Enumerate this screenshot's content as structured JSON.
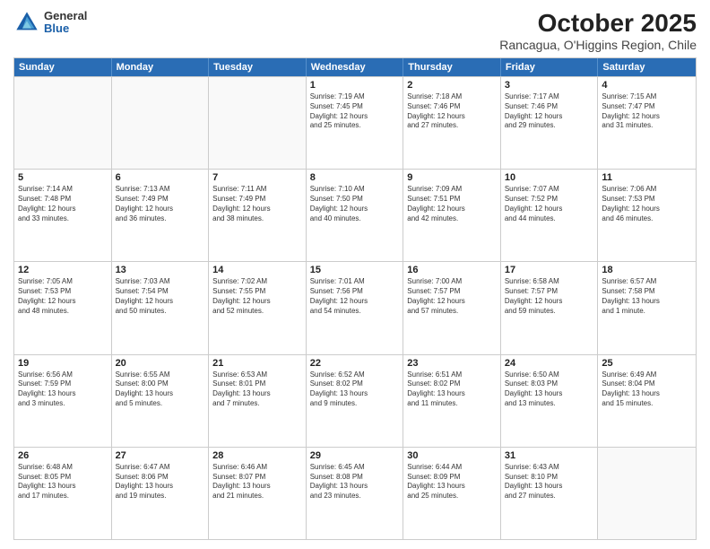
{
  "logo": {
    "general": "General",
    "blue": "Blue"
  },
  "header": {
    "title": "October 2025",
    "subtitle": "Rancagua, O'Higgins Region, Chile"
  },
  "weekdays": [
    "Sunday",
    "Monday",
    "Tuesday",
    "Wednesday",
    "Thursday",
    "Friday",
    "Saturday"
  ],
  "weeks": [
    [
      {
        "day": "",
        "info": ""
      },
      {
        "day": "",
        "info": ""
      },
      {
        "day": "",
        "info": ""
      },
      {
        "day": "1",
        "info": "Sunrise: 7:19 AM\nSunset: 7:45 PM\nDaylight: 12 hours\nand 25 minutes."
      },
      {
        "day": "2",
        "info": "Sunrise: 7:18 AM\nSunset: 7:46 PM\nDaylight: 12 hours\nand 27 minutes."
      },
      {
        "day": "3",
        "info": "Sunrise: 7:17 AM\nSunset: 7:46 PM\nDaylight: 12 hours\nand 29 minutes."
      },
      {
        "day": "4",
        "info": "Sunrise: 7:15 AM\nSunset: 7:47 PM\nDaylight: 12 hours\nand 31 minutes."
      }
    ],
    [
      {
        "day": "5",
        "info": "Sunrise: 7:14 AM\nSunset: 7:48 PM\nDaylight: 12 hours\nand 33 minutes."
      },
      {
        "day": "6",
        "info": "Sunrise: 7:13 AM\nSunset: 7:49 PM\nDaylight: 12 hours\nand 36 minutes."
      },
      {
        "day": "7",
        "info": "Sunrise: 7:11 AM\nSunset: 7:49 PM\nDaylight: 12 hours\nand 38 minutes."
      },
      {
        "day": "8",
        "info": "Sunrise: 7:10 AM\nSunset: 7:50 PM\nDaylight: 12 hours\nand 40 minutes."
      },
      {
        "day": "9",
        "info": "Sunrise: 7:09 AM\nSunset: 7:51 PM\nDaylight: 12 hours\nand 42 minutes."
      },
      {
        "day": "10",
        "info": "Sunrise: 7:07 AM\nSunset: 7:52 PM\nDaylight: 12 hours\nand 44 minutes."
      },
      {
        "day": "11",
        "info": "Sunrise: 7:06 AM\nSunset: 7:53 PM\nDaylight: 12 hours\nand 46 minutes."
      }
    ],
    [
      {
        "day": "12",
        "info": "Sunrise: 7:05 AM\nSunset: 7:53 PM\nDaylight: 12 hours\nand 48 minutes."
      },
      {
        "day": "13",
        "info": "Sunrise: 7:03 AM\nSunset: 7:54 PM\nDaylight: 12 hours\nand 50 minutes."
      },
      {
        "day": "14",
        "info": "Sunrise: 7:02 AM\nSunset: 7:55 PM\nDaylight: 12 hours\nand 52 minutes."
      },
      {
        "day": "15",
        "info": "Sunrise: 7:01 AM\nSunset: 7:56 PM\nDaylight: 12 hours\nand 54 minutes."
      },
      {
        "day": "16",
        "info": "Sunrise: 7:00 AM\nSunset: 7:57 PM\nDaylight: 12 hours\nand 57 minutes."
      },
      {
        "day": "17",
        "info": "Sunrise: 6:58 AM\nSunset: 7:57 PM\nDaylight: 12 hours\nand 59 minutes."
      },
      {
        "day": "18",
        "info": "Sunrise: 6:57 AM\nSunset: 7:58 PM\nDaylight: 13 hours\nand 1 minute."
      }
    ],
    [
      {
        "day": "19",
        "info": "Sunrise: 6:56 AM\nSunset: 7:59 PM\nDaylight: 13 hours\nand 3 minutes."
      },
      {
        "day": "20",
        "info": "Sunrise: 6:55 AM\nSunset: 8:00 PM\nDaylight: 13 hours\nand 5 minutes."
      },
      {
        "day": "21",
        "info": "Sunrise: 6:53 AM\nSunset: 8:01 PM\nDaylight: 13 hours\nand 7 minutes."
      },
      {
        "day": "22",
        "info": "Sunrise: 6:52 AM\nSunset: 8:02 PM\nDaylight: 13 hours\nand 9 minutes."
      },
      {
        "day": "23",
        "info": "Sunrise: 6:51 AM\nSunset: 8:02 PM\nDaylight: 13 hours\nand 11 minutes."
      },
      {
        "day": "24",
        "info": "Sunrise: 6:50 AM\nSunset: 8:03 PM\nDaylight: 13 hours\nand 13 minutes."
      },
      {
        "day": "25",
        "info": "Sunrise: 6:49 AM\nSunset: 8:04 PM\nDaylight: 13 hours\nand 15 minutes."
      }
    ],
    [
      {
        "day": "26",
        "info": "Sunrise: 6:48 AM\nSunset: 8:05 PM\nDaylight: 13 hours\nand 17 minutes."
      },
      {
        "day": "27",
        "info": "Sunrise: 6:47 AM\nSunset: 8:06 PM\nDaylight: 13 hours\nand 19 minutes."
      },
      {
        "day": "28",
        "info": "Sunrise: 6:46 AM\nSunset: 8:07 PM\nDaylight: 13 hours\nand 21 minutes."
      },
      {
        "day": "29",
        "info": "Sunrise: 6:45 AM\nSunset: 8:08 PM\nDaylight: 13 hours\nand 23 minutes."
      },
      {
        "day": "30",
        "info": "Sunrise: 6:44 AM\nSunset: 8:09 PM\nDaylight: 13 hours\nand 25 minutes."
      },
      {
        "day": "31",
        "info": "Sunrise: 6:43 AM\nSunset: 8:10 PM\nDaylight: 13 hours\nand 27 minutes."
      },
      {
        "day": "",
        "info": ""
      }
    ]
  ]
}
